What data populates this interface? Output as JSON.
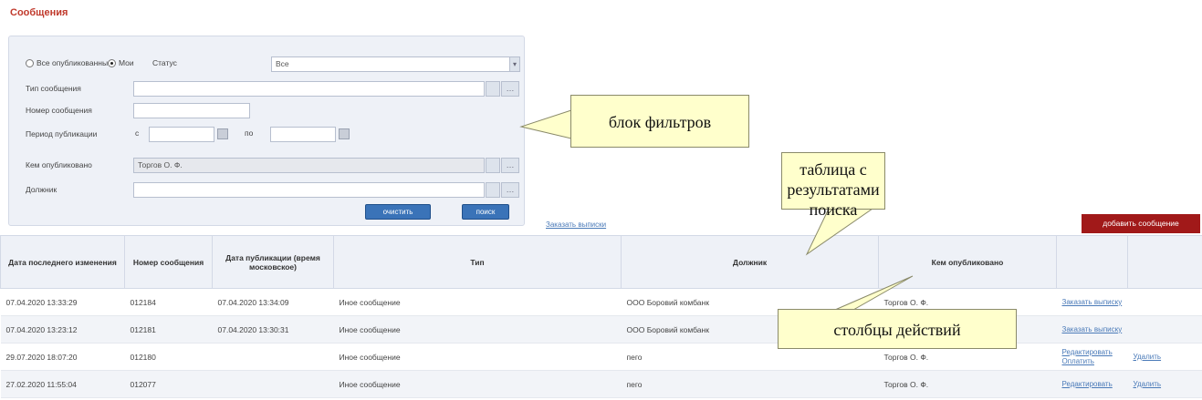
{
  "page": {
    "title": "Сообщения"
  },
  "filters": {
    "radio_all": "Все опубликованные",
    "radio_mine": "Мои",
    "status_label": "Статус",
    "status_value": "Все",
    "status_arrow": "▾",
    "type_label": "Тип сообщения",
    "type_value": "",
    "number_label": "Номер сообщения",
    "number_value": "",
    "period_label": "Период публикации",
    "period_from_label": "с",
    "period_to_label": "по",
    "period_from": "",
    "period_to": "",
    "publisher_label": "Кем опубликовано",
    "publisher_value": "Торгов О. Ф.",
    "debtor_label": "Должник",
    "debtor_value": "",
    "picker_glyph": "…",
    "clear_button": "очистить",
    "search_button": "поиск"
  },
  "toolbar": {
    "export_link": "Заказать выписки",
    "add_button": "добавить сообщение"
  },
  "table": {
    "headers": [
      "Дата последнего изменения",
      "Номер сообщения",
      "Дата публикации (время московское)",
      "Тип",
      "Должник",
      "Кем опубликовано",
      "",
      ""
    ],
    "rows": [
      {
        "changed": "07.04.2020 13:33:29",
        "number": "012184",
        "published": "07.04.2020 13:34:09",
        "type": "Иное сообщение",
        "debtor": "ООО Боровий комбанк",
        "publisher": "Торгов О. Ф.",
        "action1": "Заказать выписку",
        "action2": ""
      },
      {
        "changed": "07.04.2020 13:23:12",
        "number": "012181",
        "published": "07.04.2020 13:30:31",
        "type": "Иное сообщение",
        "debtor": "ООО Боровий комбанк",
        "publisher": "Торгов О. Ф.",
        "action1": "Заказать выписку",
        "action2": ""
      },
      {
        "changed": "29.07.2020 18:07:20",
        "number": "012180",
        "published": "",
        "type": "Иное сообщение",
        "debtor": "пего",
        "publisher": "Торгов О. Ф.",
        "action1": "Редактировать Оплатить",
        "action2": "Удалить"
      },
      {
        "changed": "27.02.2020 11:55:04",
        "number": "012077",
        "published": "",
        "type": "Иное сообщение",
        "debtor": "пего",
        "publisher": "Торгов О. Ф.",
        "action1": "Редактировать",
        "action2": "Удалить"
      }
    ]
  },
  "callouts": {
    "filters": "блок фильтров",
    "results": "таблица с результатами поиска",
    "actions": "столбцы действий"
  },
  "colors": {
    "title_red": "#c0392b",
    "add_button_bg": "#a11919",
    "search_button_bg": "#3a73b8",
    "link_blue": "#4a7ab8",
    "callout_bg": "#ffffcc"
  }
}
